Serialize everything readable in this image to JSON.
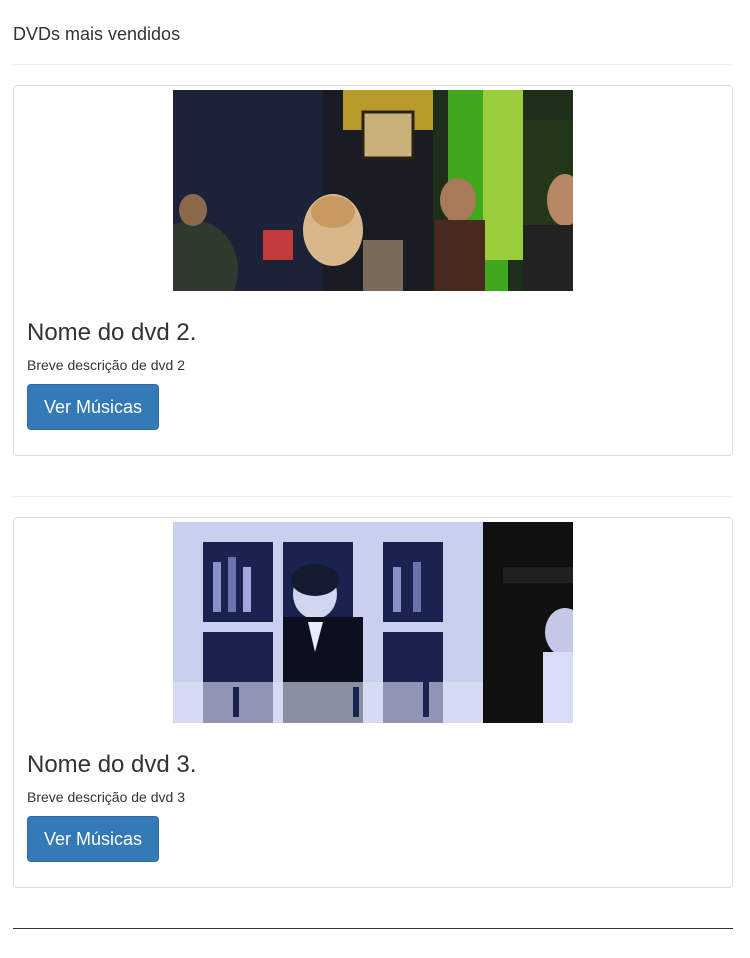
{
  "section": {
    "title": "DVDs mais vendidos"
  },
  "dvds": [
    {
      "name": "Nome do dvd 2.",
      "description": "Breve descrição de dvd 2",
      "button_label": "Ver Músicas",
      "image_alt": "bar scene with people"
    },
    {
      "name": "Nome do dvd 3.",
      "description": "Breve descrição de dvd 3",
      "button_label": "Ver Músicas",
      "image_alt": "bartender behind bottles"
    }
  ],
  "colors": {
    "button_bg": "#337ab7",
    "button_border": "#2e6da4",
    "card_border": "#dddddd",
    "divider": "#eeeeee",
    "text": "#333333"
  }
}
